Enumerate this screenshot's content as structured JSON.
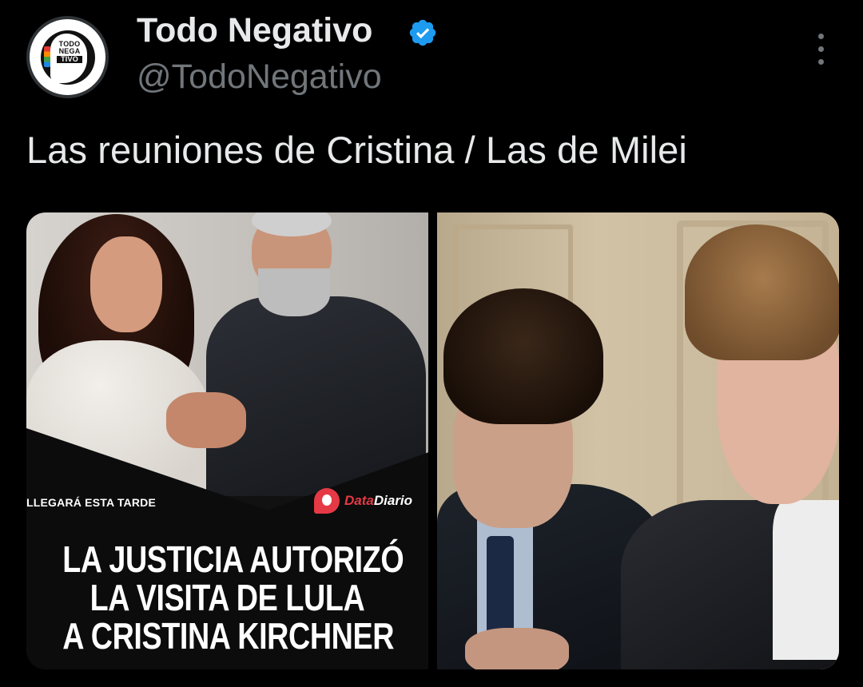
{
  "tweet": {
    "author": {
      "display_name": "Todo Negativo",
      "handle": "@TodoNegativo",
      "verified": true,
      "avatar_text": [
        "TODO",
        "NEGA",
        "TIVO"
      ]
    },
    "text": "Las reuniones de Cristina / Las de Milei",
    "media": {
      "left": {
        "kicker": "LLEGARÁ ESTA TARDE",
        "brand": {
          "part1": "Data",
          "part2": "Diario"
        },
        "headline": [
          "LA JUSTICIA AUTORIZÓ",
          "LA VISITA DE LULA",
          "A CRISTINA KIRCHNER"
        ]
      }
    }
  },
  "icons": {
    "verified": "verified-badge-icon",
    "more": "more-options-icon"
  },
  "colors": {
    "background": "#000000",
    "text": "#e7e9ea",
    "secondary_text": "#71767b",
    "verified_blue": "#1d9bf0",
    "brand_red": "#e53945"
  }
}
